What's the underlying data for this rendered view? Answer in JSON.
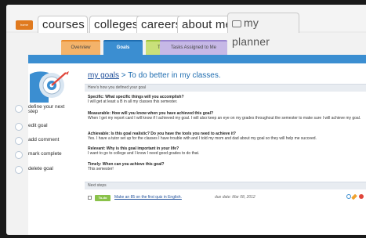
{
  "nav": {
    "home_label": "home",
    "tabs": [
      "courses",
      "colleges",
      "careers",
      "about me"
    ],
    "planner_label": "my planner"
  },
  "subtabs": [
    "Overview",
    "Goals",
    "To-do List",
    "Tasks Assigned to Me"
  ],
  "title": {
    "link": "my goals",
    "rest": " > To do better in my classes."
  },
  "section_defined": "Here's how you defined your goal",
  "qa": [
    {
      "q": "Specific: What specific things will you accomplish?",
      "a": "I will get at least a B in all my classes this semester."
    },
    {
      "q": "Measurable: How will you know when you have achieved this goal?",
      "a": "When I get my report card I will know if I achieved my goal. I will also keep an eye on my grades throughout the semester to make sure I will achieve my goal."
    },
    {
      "q": "Achievable: Is this goal realistic? Do you have the tools you need to achieve it?",
      "a": "Yes. I have a tutor set up for the classes I have trouble with and I told my mom and dad about my goal so they will help me succeed."
    },
    {
      "q": "Relevant: Why is this goal important in your life?",
      "a": "I want to go to college and I know I need good grades to do that."
    },
    {
      "q": "Timely: When can you achieve this goal?",
      "a": "This semester!"
    }
  ],
  "section_next": "Next steps",
  "step": {
    "badge": "To-do",
    "text": "Make an 85 on the first quiz in English.",
    "due": "due date: Mar 08, 2012"
  },
  "side_actions": [
    "define your next step",
    "edit goal",
    "add comment",
    "mark complete",
    "delete goal"
  ],
  "colors": {
    "accent": "#3b8ed1",
    "orange": "#e07a1f",
    "green": "#8ac24a"
  }
}
